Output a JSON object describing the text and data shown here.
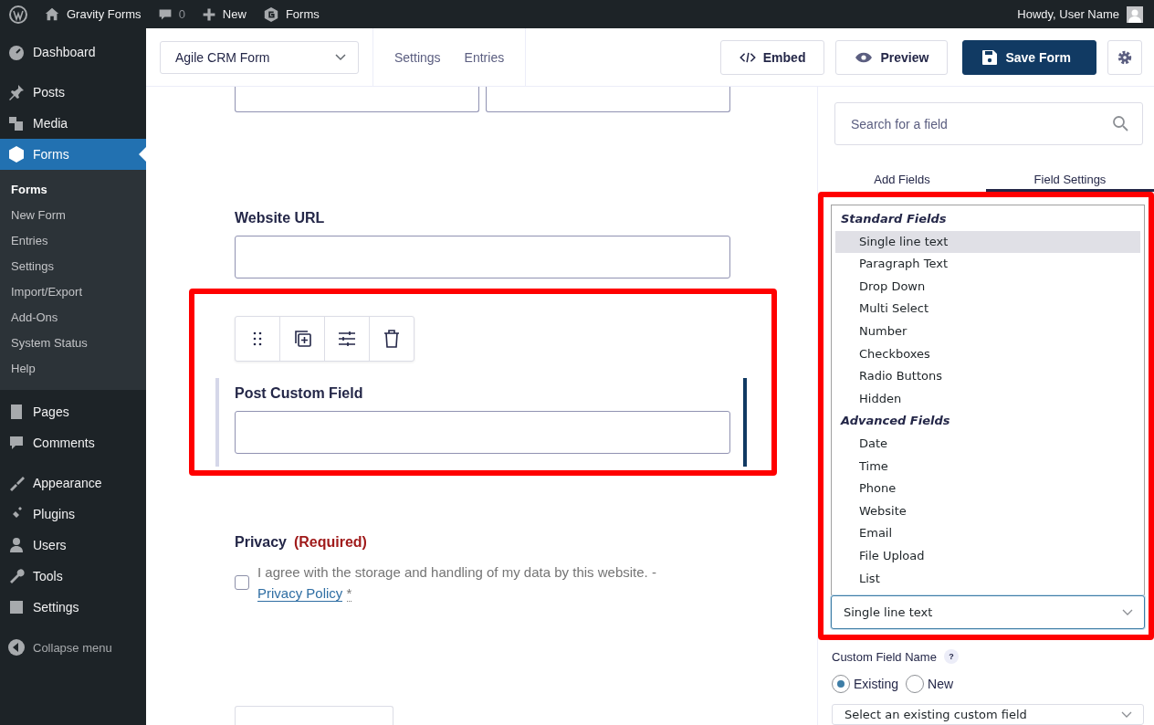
{
  "admin_bar": {
    "site_name": "Gravity Forms",
    "comments_count": "0",
    "new_label": "New",
    "forms_label": "Forms",
    "greeting": "Howdy, User Name"
  },
  "sidebar": {
    "groups": [
      {
        "items": [
          {
            "label": "Dashboard",
            "selected": false
          }
        ]
      },
      {
        "items": [
          {
            "label": "Posts",
            "selected": false
          },
          {
            "label": "Media",
            "selected": false
          },
          {
            "label": "Forms",
            "selected": true,
            "children": [
              {
                "label": "Forms",
                "selected": true
              },
              {
                "label": "New Form",
                "selected": false
              },
              {
                "label": "Entries",
                "selected": false
              },
              {
                "label": "Settings",
                "selected": false
              },
              {
                "label": "Import/Export",
                "selected": false
              },
              {
                "label": "Add-Ons",
                "selected": false
              },
              {
                "label": "System Status",
                "selected": false
              },
              {
                "label": "Help",
                "selected": false
              }
            ]
          },
          {
            "label": "Pages",
            "selected": false
          },
          {
            "label": "Comments",
            "selected": false
          }
        ]
      },
      {
        "items": [
          {
            "label": "Appearance",
            "selected": false
          },
          {
            "label": "Plugins",
            "selected": false
          },
          {
            "label": "Users",
            "selected": false
          },
          {
            "label": "Tools",
            "selected": false
          },
          {
            "label": "Settings",
            "selected": false
          }
        ]
      }
    ],
    "collapse_label": "Collapse menu"
  },
  "toolbar": {
    "form_select": "Agile CRM Form",
    "links": [
      "Settings",
      "Entries"
    ],
    "embed": "Embed",
    "preview": "Preview",
    "save": "Save Form"
  },
  "canvas": {
    "website_label": "Website URL",
    "custom_field_label": "Post Custom Field",
    "privacy_label": "Privacy",
    "required_text": "(Required)",
    "consent_text": "I agree with the storage and handling of my data by this website. -",
    "consent_link": "Privacy Policy",
    "consent_asterisk": "*",
    "consent_checked": false
  },
  "panel": {
    "search_placeholder": "Search for a field",
    "tabs": [
      {
        "label": "Add Fields",
        "selected": false
      },
      {
        "label": "Field Settings",
        "selected": true
      }
    ],
    "listbox": [
      {
        "group": "Standard Fields",
        "options": [
          {
            "label": "Single line text",
            "selected": true
          },
          {
            "label": "Paragraph Text",
            "selected": false
          },
          {
            "label": "Drop Down",
            "selected": false
          },
          {
            "label": "Multi Select",
            "selected": false
          },
          {
            "label": "Number",
            "selected": false
          },
          {
            "label": "Checkboxes",
            "selected": false
          },
          {
            "label": "Radio Buttons",
            "selected": false
          },
          {
            "label": "Hidden",
            "selected": false
          }
        ]
      },
      {
        "group": "Advanced Fields",
        "options": [
          {
            "label": "Date",
            "selected": false
          },
          {
            "label": "Time",
            "selected": false
          },
          {
            "label": "Phone",
            "selected": false
          },
          {
            "label": "Website",
            "selected": false
          },
          {
            "label": "Email",
            "selected": false
          },
          {
            "label": "File Upload",
            "selected": false
          },
          {
            "label": "List",
            "selected": false
          }
        ]
      }
    ],
    "type_select": "Single line text",
    "custom_field_name_label": "Custom Field Name",
    "help_mark": "?",
    "radios": [
      {
        "label": "Existing",
        "selected": true
      },
      {
        "label": "New",
        "selected": false
      }
    ],
    "existing_select": "Select an existing custom field"
  }
}
